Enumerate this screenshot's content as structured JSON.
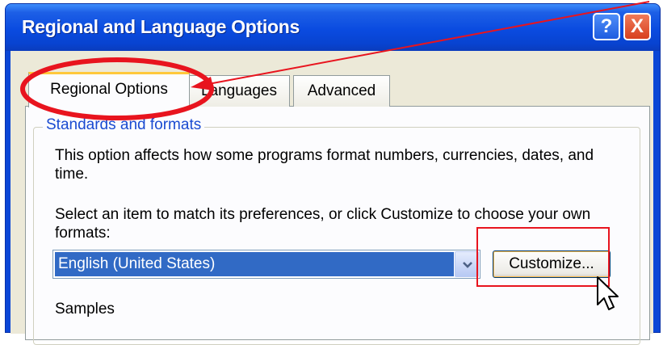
{
  "window": {
    "title": "Regional and Language Options",
    "help_glyph": "?",
    "close_glyph": "X"
  },
  "tabs": [
    {
      "label": "Regional Options",
      "selected": true
    },
    {
      "label": "Languages",
      "selected": false
    },
    {
      "label": "Advanced",
      "selected": false
    }
  ],
  "standards": {
    "group_title": "Standards and formats",
    "description": "This option affects how some programs format numbers, currencies, dates, and time.",
    "instruction": "Select an item to match its preferences, or click Customize to choose your own formats:",
    "locale_select": {
      "value": "English (United States)"
    },
    "customize_label": "Customize..."
  },
  "samples": {
    "label": "Samples"
  },
  "colors": {
    "titlebar": "#0a46d6",
    "annotation_red": "#e8141e",
    "selection": "#316ac5",
    "group_title": "#1a4bd1"
  },
  "icons": {
    "help": "help-icon",
    "close": "close-icon",
    "dropdown": "chevron-down-icon",
    "cursor": "mouse-pointer-icon"
  }
}
